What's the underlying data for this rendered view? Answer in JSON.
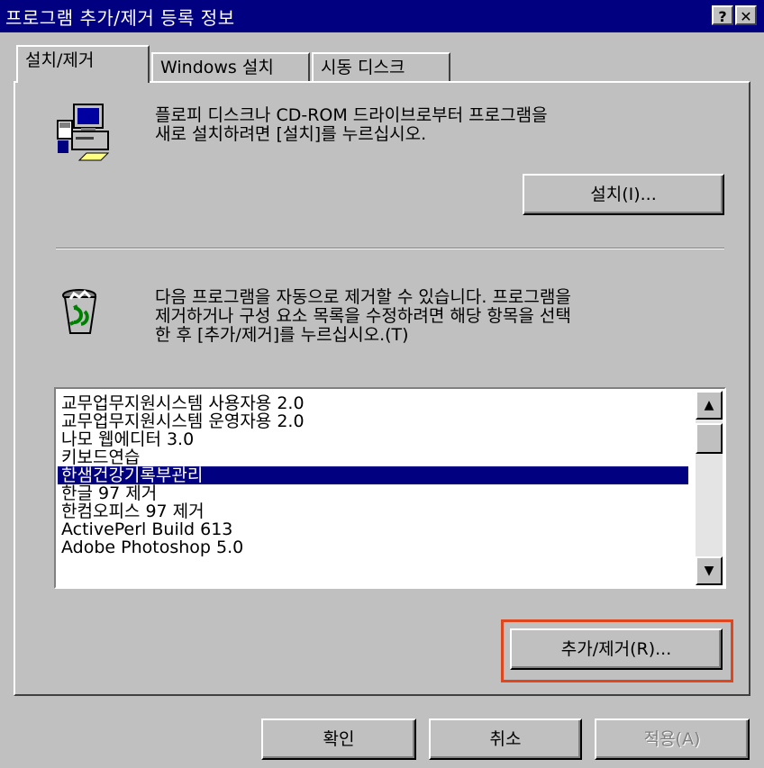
{
  "window": {
    "title": "프로그램 추가/제거 등록 정보",
    "help_btn": "?",
    "close_btn": "✕"
  },
  "tabs": [
    {
      "label": "설치/제거",
      "active": true
    },
    {
      "label": "Windows 설치",
      "active": false
    },
    {
      "label": "시동 디스크",
      "active": false
    }
  ],
  "install": {
    "icon": "computer-install-icon",
    "desc_line1": "플로피 디스크나 CD-ROM 드라이브로부터 프로그램을",
    "desc_line2": "새로 설치하려면 [설치]를 누르십시오.",
    "button_label": "설치(I)..."
  },
  "remove": {
    "icon": "recycle-bin-icon",
    "desc_line1": "다음 프로그램을 자동으로 제거할 수 있습니다. 프로그램을",
    "desc_line2": "제거하거나 구성 요소 목록을 수정하려면 해당 항목을 선택",
    "desc_line3": "한 후 [추가/제거]를 누르십시오.(T)",
    "button_label": "추가/제거(R)...",
    "programs": [
      {
        "name": "교무업무지원시스템 사용자용 2.0",
        "selected": false
      },
      {
        "name": "교무업무지원시스템 운영자용 2.0",
        "selected": false
      },
      {
        "name": "나모 웹에디터 3.0",
        "selected": false
      },
      {
        "name": "키보드연습",
        "selected": false
      },
      {
        "name": "한샘건강기록부관리",
        "selected": true
      },
      {
        "name": "한글 97 제거",
        "selected": false
      },
      {
        "name": "한컴오피스 97 제거",
        "selected": false
      },
      {
        "name": "ActivePerl Build 613",
        "selected": false
      },
      {
        "name": "Adobe Photoshop 5.0",
        "selected": false
      }
    ]
  },
  "footer": {
    "ok": "확인",
    "cancel": "취소",
    "apply": "적용(A)"
  },
  "colors": {
    "titlebar": "#000080",
    "face": "#c0c0c0",
    "selection": "#000080",
    "highlight_box": "#e0461e"
  }
}
